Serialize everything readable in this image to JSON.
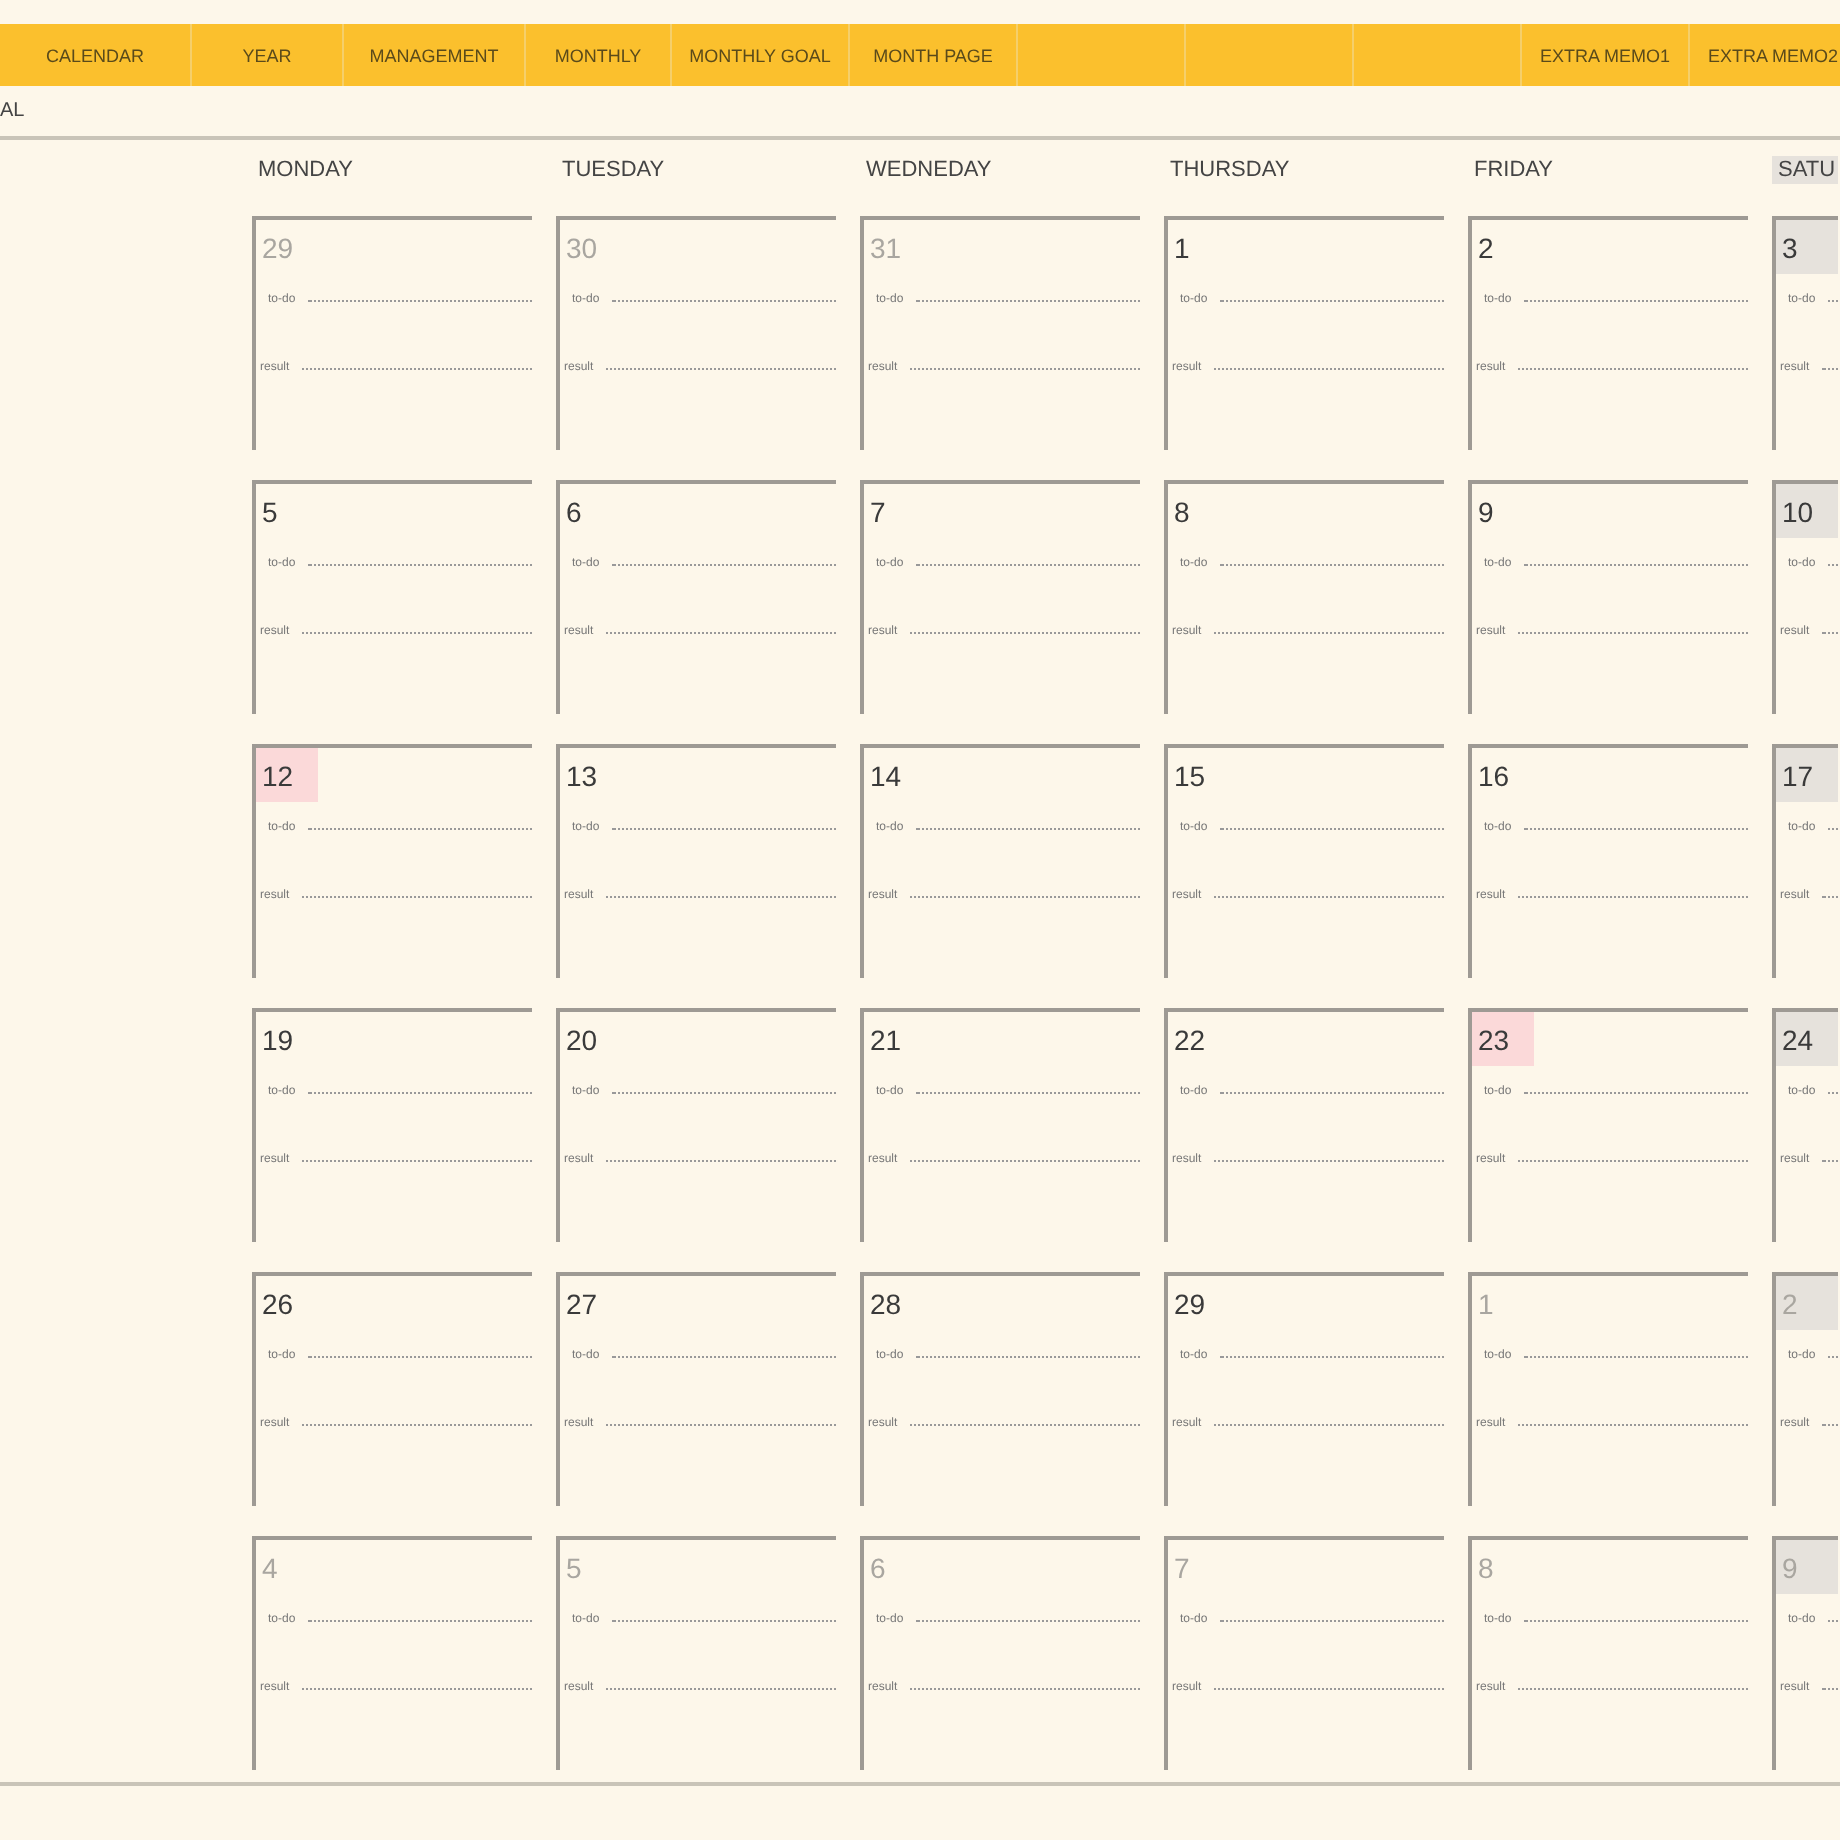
{
  "nav": {
    "left": [
      "CALENDAR",
      "YEAR",
      "MANAGEMENT",
      "MONTHLY",
      "MONTHLY GOAL",
      "MONTH PAGE"
    ],
    "right": [
      "EXTRA MEMO1",
      "EXTRA MEMO2"
    ]
  },
  "subtitle": "AL",
  "days": [
    {
      "label": "MONDAY",
      "shaded": false
    },
    {
      "label": "TUESDAY",
      "shaded": false
    },
    {
      "label": "WEDNEDAY",
      "shaded": false
    },
    {
      "label": "THURSDAY",
      "shaded": false
    },
    {
      "label": "FRIDAY",
      "shaded": false
    },
    {
      "label": "SATU",
      "shaded": true
    }
  ],
  "weeks": [
    [
      {
        "day": "29",
        "muted": true,
        "kind": "plain",
        "todo": "to-do",
        "result": "result"
      },
      {
        "day": "30",
        "muted": true,
        "kind": "plain",
        "todo": "to-do",
        "result": "result"
      },
      {
        "day": "31",
        "muted": true,
        "kind": "plain",
        "todo": "to-do",
        "result": "result"
      },
      {
        "day": "1",
        "muted": false,
        "kind": "plain",
        "todo": "to-do",
        "result": "result"
      },
      {
        "day": "2",
        "muted": false,
        "kind": "plain",
        "todo": "to-do",
        "result": "result"
      },
      {
        "day": "3",
        "muted": false,
        "kind": "weekend",
        "todo": "to-do",
        "result": "result"
      }
    ],
    [
      {
        "day": "5",
        "muted": false,
        "kind": "plain",
        "todo": "to-do",
        "result": "result"
      },
      {
        "day": "6",
        "muted": false,
        "kind": "plain",
        "todo": "to-do",
        "result": "result"
      },
      {
        "day": "7",
        "muted": false,
        "kind": "plain",
        "todo": "to-do",
        "result": "result"
      },
      {
        "day": "8",
        "muted": false,
        "kind": "plain",
        "todo": "to-do",
        "result": "result"
      },
      {
        "day": "9",
        "muted": false,
        "kind": "plain",
        "todo": "to-do",
        "result": "result"
      },
      {
        "day": "10",
        "muted": false,
        "kind": "weekend",
        "todo": "to-do",
        "result": "result"
      }
    ],
    [
      {
        "day": "12",
        "muted": false,
        "kind": "holiday",
        "todo": "to-do",
        "result": "result"
      },
      {
        "day": "13",
        "muted": false,
        "kind": "plain",
        "todo": "to-do",
        "result": "result"
      },
      {
        "day": "14",
        "muted": false,
        "kind": "plain",
        "todo": "to-do",
        "result": "result"
      },
      {
        "day": "15",
        "muted": false,
        "kind": "plain",
        "todo": "to-do",
        "result": "result"
      },
      {
        "day": "16",
        "muted": false,
        "kind": "plain",
        "todo": "to-do",
        "result": "result"
      },
      {
        "day": "17",
        "muted": false,
        "kind": "weekend",
        "todo": "to-do",
        "result": "result"
      }
    ],
    [
      {
        "day": "19",
        "muted": false,
        "kind": "plain",
        "todo": "to-do",
        "result": "result"
      },
      {
        "day": "20",
        "muted": false,
        "kind": "plain",
        "todo": "to-do",
        "result": "result"
      },
      {
        "day": "21",
        "muted": false,
        "kind": "plain",
        "todo": "to-do",
        "result": "result"
      },
      {
        "day": "22",
        "muted": false,
        "kind": "plain",
        "todo": "to-do",
        "result": "result"
      },
      {
        "day": "23",
        "muted": false,
        "kind": "holiday",
        "todo": "to-do",
        "result": "result"
      },
      {
        "day": "24",
        "muted": false,
        "kind": "weekend",
        "todo": "to-do",
        "result": "result"
      }
    ],
    [
      {
        "day": "26",
        "muted": false,
        "kind": "plain",
        "todo": "to-do",
        "result": "result"
      },
      {
        "day": "27",
        "muted": false,
        "kind": "plain",
        "todo": "to-do",
        "result": "result"
      },
      {
        "day": "28",
        "muted": false,
        "kind": "plain",
        "todo": "to-do",
        "result": "result"
      },
      {
        "day": "29",
        "muted": false,
        "kind": "plain",
        "todo": "to-do",
        "result": "result"
      },
      {
        "day": "1",
        "muted": true,
        "kind": "plain",
        "todo": "to-do",
        "result": "result"
      },
      {
        "day": "2",
        "muted": true,
        "kind": "weekend",
        "todo": "to-do",
        "result": "result"
      }
    ],
    [
      {
        "day": "4",
        "muted": true,
        "kind": "plain",
        "todo": "to-do",
        "result": "result"
      },
      {
        "day": "5",
        "muted": true,
        "kind": "plain",
        "todo": "to-do",
        "result": "result"
      },
      {
        "day": "6",
        "muted": true,
        "kind": "plain",
        "todo": "to-do",
        "result": "result"
      },
      {
        "day": "7",
        "muted": true,
        "kind": "plain",
        "todo": "to-do",
        "result": "result"
      },
      {
        "day": "8",
        "muted": true,
        "kind": "plain",
        "todo": "to-do",
        "result": "result"
      },
      {
        "day": "9",
        "muted": true,
        "kind": "weekend",
        "todo": "to-do",
        "result": "result"
      }
    ]
  ]
}
